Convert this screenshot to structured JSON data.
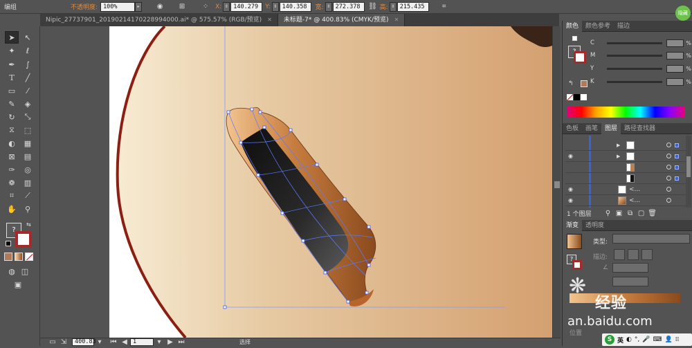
{
  "control_bar": {
    "selection": "编组",
    "opacity_label": "不透明度:",
    "opacity_value": "100%",
    "x_label": "X:",
    "x_value": "140.279",
    "y_label": "Y:",
    "y_value": "140.358",
    "w_label": "宽:",
    "w_value": "272.378",
    "h_label": "高:",
    "h_value": "215.435",
    "unit": "n"
  },
  "doc_tabs": [
    {
      "label": "Nipic_27737901_20190214170228994000.ai* @ 575.57% (RGB/预览)"
    },
    {
      "label": "未标题-7* @ 400.83% (CMYK/预览)"
    }
  ],
  "color_panel": {
    "tabs": [
      "颜色",
      "颜色参考",
      "描边"
    ],
    "channels": [
      {
        "key": "C"
      },
      {
        "key": "M"
      },
      {
        "key": "Y"
      },
      {
        "key": "K"
      }
    ],
    "percent": "%"
  },
  "layers_panel": {
    "tabs": [
      "色板",
      "画笔",
      "图层",
      "路径查找器"
    ],
    "rows": [
      {
        "name": ""
      },
      {
        "name": ""
      },
      {
        "name": ""
      },
      {
        "name": ""
      },
      {
        "name": "<..."
      },
      {
        "name": "<..."
      }
    ],
    "footer": "1 个图层"
  },
  "gradient_panel": {
    "tabs": [
      "渐变",
      "透明度"
    ],
    "type_label": "类型:",
    "stroke_label": "描边:",
    "position_label": "位置"
  },
  "status_bar": {
    "zoom": "400.83",
    "artboard": "1",
    "tool_name": "选择"
  },
  "watermark": {
    "brand": "百度经验",
    "url": "jingyan.baidu.com",
    "visible_url": "an.baidu.com",
    "visible_text": "经验"
  },
  "tray": {
    "ime": "英",
    "ime_logo": "S"
  },
  "badge": {
    "label": "隐藏"
  },
  "colors": {
    "accent_orange": "#e08a3c",
    "panel_bg": "#535353",
    "swatch_fill": "#b07a5a"
  }
}
